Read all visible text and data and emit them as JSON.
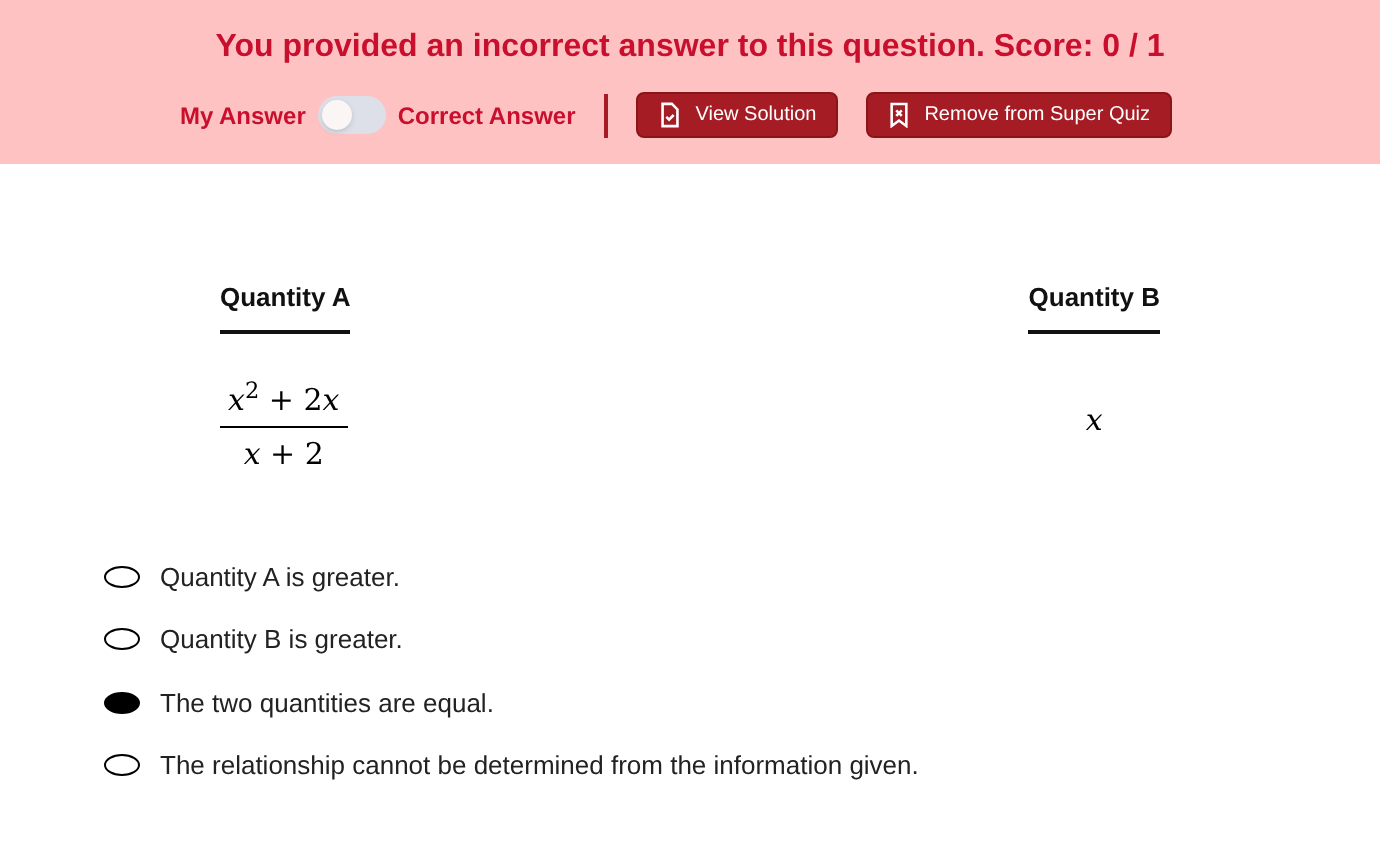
{
  "banner": {
    "message": "You provided an incorrect answer to this question. Score: 0 / 1",
    "toggle": {
      "left_label": "My Answer",
      "right_label": "Correct Answer",
      "on": false
    },
    "buttons": [
      {
        "label": "View Solution",
        "kind": "solution"
      },
      {
        "label": "Remove from Super Quiz",
        "kind": "bookmark"
      }
    ]
  },
  "quantities": {
    "a": {
      "heading": "Quantity A",
      "numerator": [
        {
          "text": "x",
          "kind": "variable"
        },
        {
          "text": "$^{2}$ + 2",
          "kind": "plain"
        },
        {
          "text": "x",
          "kind": "variable"
        }
      ],
      "denominator": "*x* + 2"
    },
    "b": {
      "heading": "Quantity B",
      "value": "x"
    }
  },
  "options": [
    {
      "label": "Quantity A is greater.",
      "selected": false
    },
    {
      "label": "Quantity B is greater.",
      "selected": false
    },
    {
      "label": "The two quantities are equal.",
      "selected": true
    },
    {
      "label": "The relationship cannot be determined from the information given.",
      "selected": false
    }
  ]
}
